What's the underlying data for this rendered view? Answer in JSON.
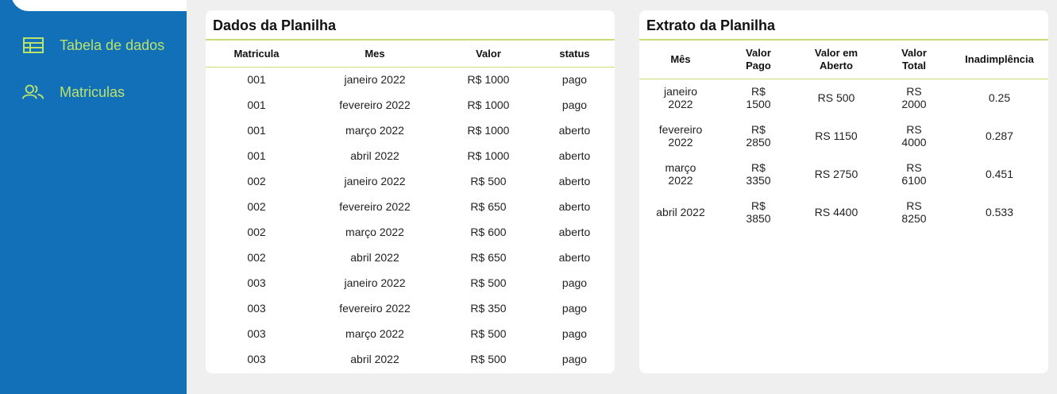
{
  "colors": {
    "sidebar_bg": "#1170b8",
    "accent_green": "#b9e26a",
    "divider": "#c7df74",
    "page_bg": "#efefef"
  },
  "sidebar": {
    "items": [
      {
        "label": "Tabela de dados",
        "icon": "table-icon"
      },
      {
        "label": "Matriculas",
        "icon": "users-icon"
      }
    ]
  },
  "dados": {
    "title": "Dados da Planilha",
    "columns": [
      "Matricula",
      "Mes",
      "Valor",
      "status"
    ],
    "rows": [
      [
        "001",
        "janeiro 2022",
        "R$ 1000",
        "pago"
      ],
      [
        "001",
        "fevereiro 2022",
        "R$ 1000",
        "pago"
      ],
      [
        "001",
        "março 2022",
        "R$ 1000",
        "aberto"
      ],
      [
        "001",
        "abril 2022",
        "R$ 1000",
        "aberto"
      ],
      [
        "002",
        "janeiro 2022",
        "R$ 500",
        "aberto"
      ],
      [
        "002",
        "fevereiro 2022",
        "R$ 650",
        "aberto"
      ],
      [
        "002",
        "março 2022",
        "R$ 600",
        "aberto"
      ],
      [
        "002",
        "abril 2022",
        "R$ 650",
        "aberto"
      ],
      [
        "003",
        "janeiro 2022",
        "R$ 500",
        "pago"
      ],
      [
        "003",
        "fevereiro 2022",
        "R$ 350",
        "pago"
      ],
      [
        "003",
        "março 2022",
        "R$ 500",
        "pago"
      ],
      [
        "003",
        "abril 2022",
        "R$ 500",
        "pago"
      ]
    ]
  },
  "extrato": {
    "title": "Extrato da Planilha",
    "columns": [
      "Mês",
      "Valor Pago",
      "Valor em Aberto",
      "Valor Total",
      "Inadimplência"
    ],
    "rows": [
      [
        "janeiro 2022",
        "R$ 1500",
        "RS 500",
        "RS 2000",
        "0.25"
      ],
      [
        "fevereiro 2022",
        "R$ 2850",
        "RS 1150",
        "RS 4000",
        "0.287"
      ],
      [
        "março 2022",
        "R$ 3350",
        "RS 2750",
        "RS 6100",
        "0.451"
      ],
      [
        "abril 2022",
        "R$ 3850",
        "RS 4400",
        "RS 8250",
        "0.533"
      ]
    ]
  }
}
